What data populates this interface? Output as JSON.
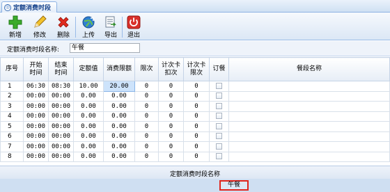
{
  "tab": {
    "title": "定额消费时段"
  },
  "toolbar": {
    "add_label": "新增",
    "edit_label": "修改",
    "delete_label": "删除",
    "upload_label": "上传",
    "export_label": "导出",
    "exit_label": "退出"
  },
  "form": {
    "period_name_label": "定额消费时段名称:",
    "period_name_value": "午餐"
  },
  "grid": {
    "headers": {
      "no": "序号",
      "start_time": "开始\n时间",
      "end_time": "结束\n时间",
      "fixed_amount": "定额值",
      "limit_amount": "消费限额",
      "limit_times": "限次",
      "card_deduct_times": "计次卡\n扣次",
      "card_limit_times": "计次卡\n限次",
      "order": "订餐",
      "meal_name": "餐段名称"
    },
    "rows": [
      {
        "no": "1",
        "start": "06:30",
        "end": "08:30",
        "fixed": "10.00",
        "limit": "20.00",
        "limit_times": "0",
        "deduct": "0",
        "card_limit": "0",
        "meal": ""
      },
      {
        "no": "2",
        "start": "00:00",
        "end": "00:00",
        "fixed": "0.00",
        "limit": "0.00",
        "limit_times": "0",
        "deduct": "0",
        "card_limit": "0",
        "meal": ""
      },
      {
        "no": "3",
        "start": "00:00",
        "end": "00:00",
        "fixed": "0.00",
        "limit": "0.00",
        "limit_times": "0",
        "deduct": "0",
        "card_limit": "0",
        "meal": ""
      },
      {
        "no": "4",
        "start": "00:00",
        "end": "00:00",
        "fixed": "0.00",
        "limit": "0.00",
        "limit_times": "0",
        "deduct": "0",
        "card_limit": "0",
        "meal": ""
      },
      {
        "no": "5",
        "start": "00:00",
        "end": "00:00",
        "fixed": "0.00",
        "limit": "0.00",
        "limit_times": "0",
        "deduct": "0",
        "card_limit": "0",
        "meal": ""
      },
      {
        "no": "6",
        "start": "00:00",
        "end": "00:00",
        "fixed": "0.00",
        "limit": "0.00",
        "limit_times": "0",
        "deduct": "0",
        "card_limit": "0",
        "meal": ""
      },
      {
        "no": "7",
        "start": "00:00",
        "end": "00:00",
        "fixed": "0.00",
        "limit": "0.00",
        "limit_times": "0",
        "deduct": "0",
        "card_limit": "0",
        "meal": ""
      },
      {
        "no": "8",
        "start": "00:00",
        "end": "00:00",
        "fixed": "0.00",
        "limit": "0.00",
        "limit_times": "0",
        "deduct": "0",
        "card_limit": "0",
        "meal": ""
      }
    ]
  },
  "footer": {
    "column_title": "定额消费时段名称",
    "selected_value": "午餐"
  },
  "colors": {
    "accent": "#15428b",
    "highlight_border": "#e0251d",
    "active_cell": "#cde3fb"
  }
}
